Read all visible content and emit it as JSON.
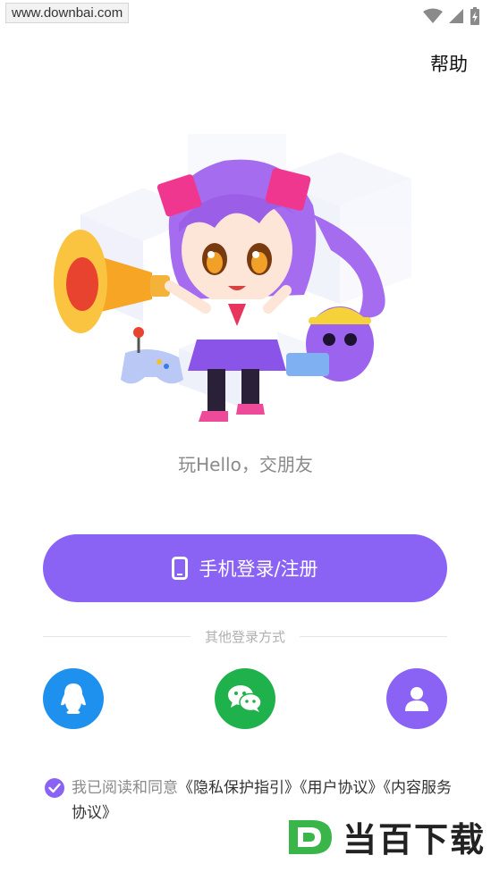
{
  "status_bar": {
    "watermark": "www.downbai.com",
    "icons": [
      "wifi-icon",
      "signal-icon",
      "battery-icon"
    ]
  },
  "header": {
    "help_label": "帮助"
  },
  "hero": {
    "illustration": "anime-girl-megaphone-mascot"
  },
  "tagline": "玩Hello，交朋友",
  "login": {
    "phone_button_label": "手机登录/注册",
    "icon": "phone-icon"
  },
  "other_login": {
    "label": "其他登录方式",
    "methods": [
      {
        "icon": "qq-icon",
        "color": "#1e90ee"
      },
      {
        "icon": "wechat-icon",
        "color": "#1fb14b"
      },
      {
        "icon": "user-icon",
        "color": "#8a63f5"
      }
    ]
  },
  "agreement": {
    "checked": true,
    "prefix": "我已阅读和同意",
    "privacy": "《隐私保护指引》",
    "user": "《用户协议》",
    "content": "《内容服务协议》"
  },
  "brand_watermark": {
    "text": "当百下载"
  },
  "colors": {
    "accent": "#8a63f5",
    "qq": "#1e90ee",
    "wechat": "#1fb14b"
  }
}
